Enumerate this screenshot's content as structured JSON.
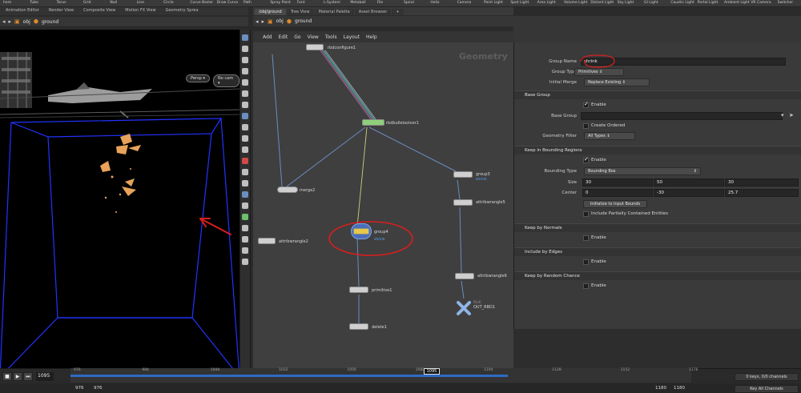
{
  "shelf_top": {
    "items": [
      "here",
      "Tube",
      "Torus",
      "Grid",
      "Null",
      "Line",
      "Circle",
      "Curve Bezier",
      "Draw Curve",
      "Path",
      "Spray Paint",
      "Font",
      "L-System",
      "Metaball",
      "File",
      "Spiral",
      "Helix",
      "Camera",
      "Point Light",
      "Spot Light",
      "Area Light",
      "Volume Light",
      "Distant Light",
      "Sky Light",
      "GI Light",
      "Caustic Light",
      "Portal Light",
      "Ambient Light",
      "VR Camera",
      "Switcher"
    ]
  },
  "shelf_tabs": [
    "Animation Editor",
    "Render View",
    "Composite View",
    "Motion FX View",
    "Geometry Sprea"
  ],
  "left_pane": {
    "path": {
      "obj": "obj",
      "node": "ground"
    },
    "persp_label": "Persp",
    "cam_label": "No cam"
  },
  "net_tabs": [
    "/obj/ground",
    "Tree View",
    "Material Palette",
    "Asset Browser"
  ],
  "net_path": {
    "obj": "obj",
    "node": "ground"
  },
  "net_menu": [
    "Add",
    "Edit",
    "Go",
    "View",
    "Tools",
    "Layout",
    "Help"
  ],
  "net_title": "Geometry",
  "nodes": [
    {
      "name": "rbdconfigure1"
    },
    {
      "name": "rbdbulletsolver1"
    },
    {
      "name": "merge2"
    },
    {
      "name": "group3",
      "sub": "shrink"
    },
    {
      "name": "attribwrangle5"
    },
    {
      "name": "group4",
      "sub": "shrink"
    },
    {
      "name": "attribwrangle2"
    },
    {
      "name": "attribwrangle6"
    },
    {
      "name": "primitive1"
    },
    {
      "name": "OUT_RBD1",
      "pre": "Null"
    },
    {
      "name": "delete1"
    }
  ],
  "params": {
    "op_type": "Group Create",
    "op_name": "group4",
    "group_name_label": "Group Name",
    "group_name_value": "shrink",
    "group_type_label": "Group Type",
    "group_type_value": "Primitives",
    "initial_merge_label": "Initial Merge",
    "initial_merge_value": "Replace Existing",
    "base_group_section": "Base Group",
    "enable_label": "Enable",
    "base_group_label": "Base Group",
    "create_ordered_label": "Create Ordered",
    "geometry_filter_label": "Geometry Filter",
    "geometry_filter_value": "All Types",
    "bounding_section": "Keep in Bounding Regions",
    "bounding_type_label": "Bounding Type",
    "bounding_type_value": "Bounding Box",
    "size_label": "Size",
    "size": [
      "30",
      "50",
      "30"
    ],
    "center_label": "Center",
    "center": [
      "0",
      "-30",
      "25.7"
    ],
    "init_bounds_button": "Initialize to Input Bounds",
    "partial_label": "Include Partially Contained Entities",
    "normals_section": "Keep by Normals",
    "edges_section": "Include by Edges",
    "random_section": "Keep by Random Chance"
  },
  "timeline": {
    "current_frame": "1095",
    "ticks": [
      "976",
      "984",
      "1008",
      "1032",
      "1056",
      "1080",
      "1104",
      "1128",
      "1152",
      "1176"
    ],
    "keys_label": "0 keys, 0/0 channels",
    "all_channels": "Key All Channels",
    "start_a": "976",
    "start_b": "976",
    "end_a": "1180",
    "end_b": "1180"
  },
  "colors": {
    "annotation_red": "#d81e1e",
    "viewport_bounds": "#2233ff",
    "node_selected": "#e6c84a",
    "time_blue": "#2e6bc4"
  }
}
